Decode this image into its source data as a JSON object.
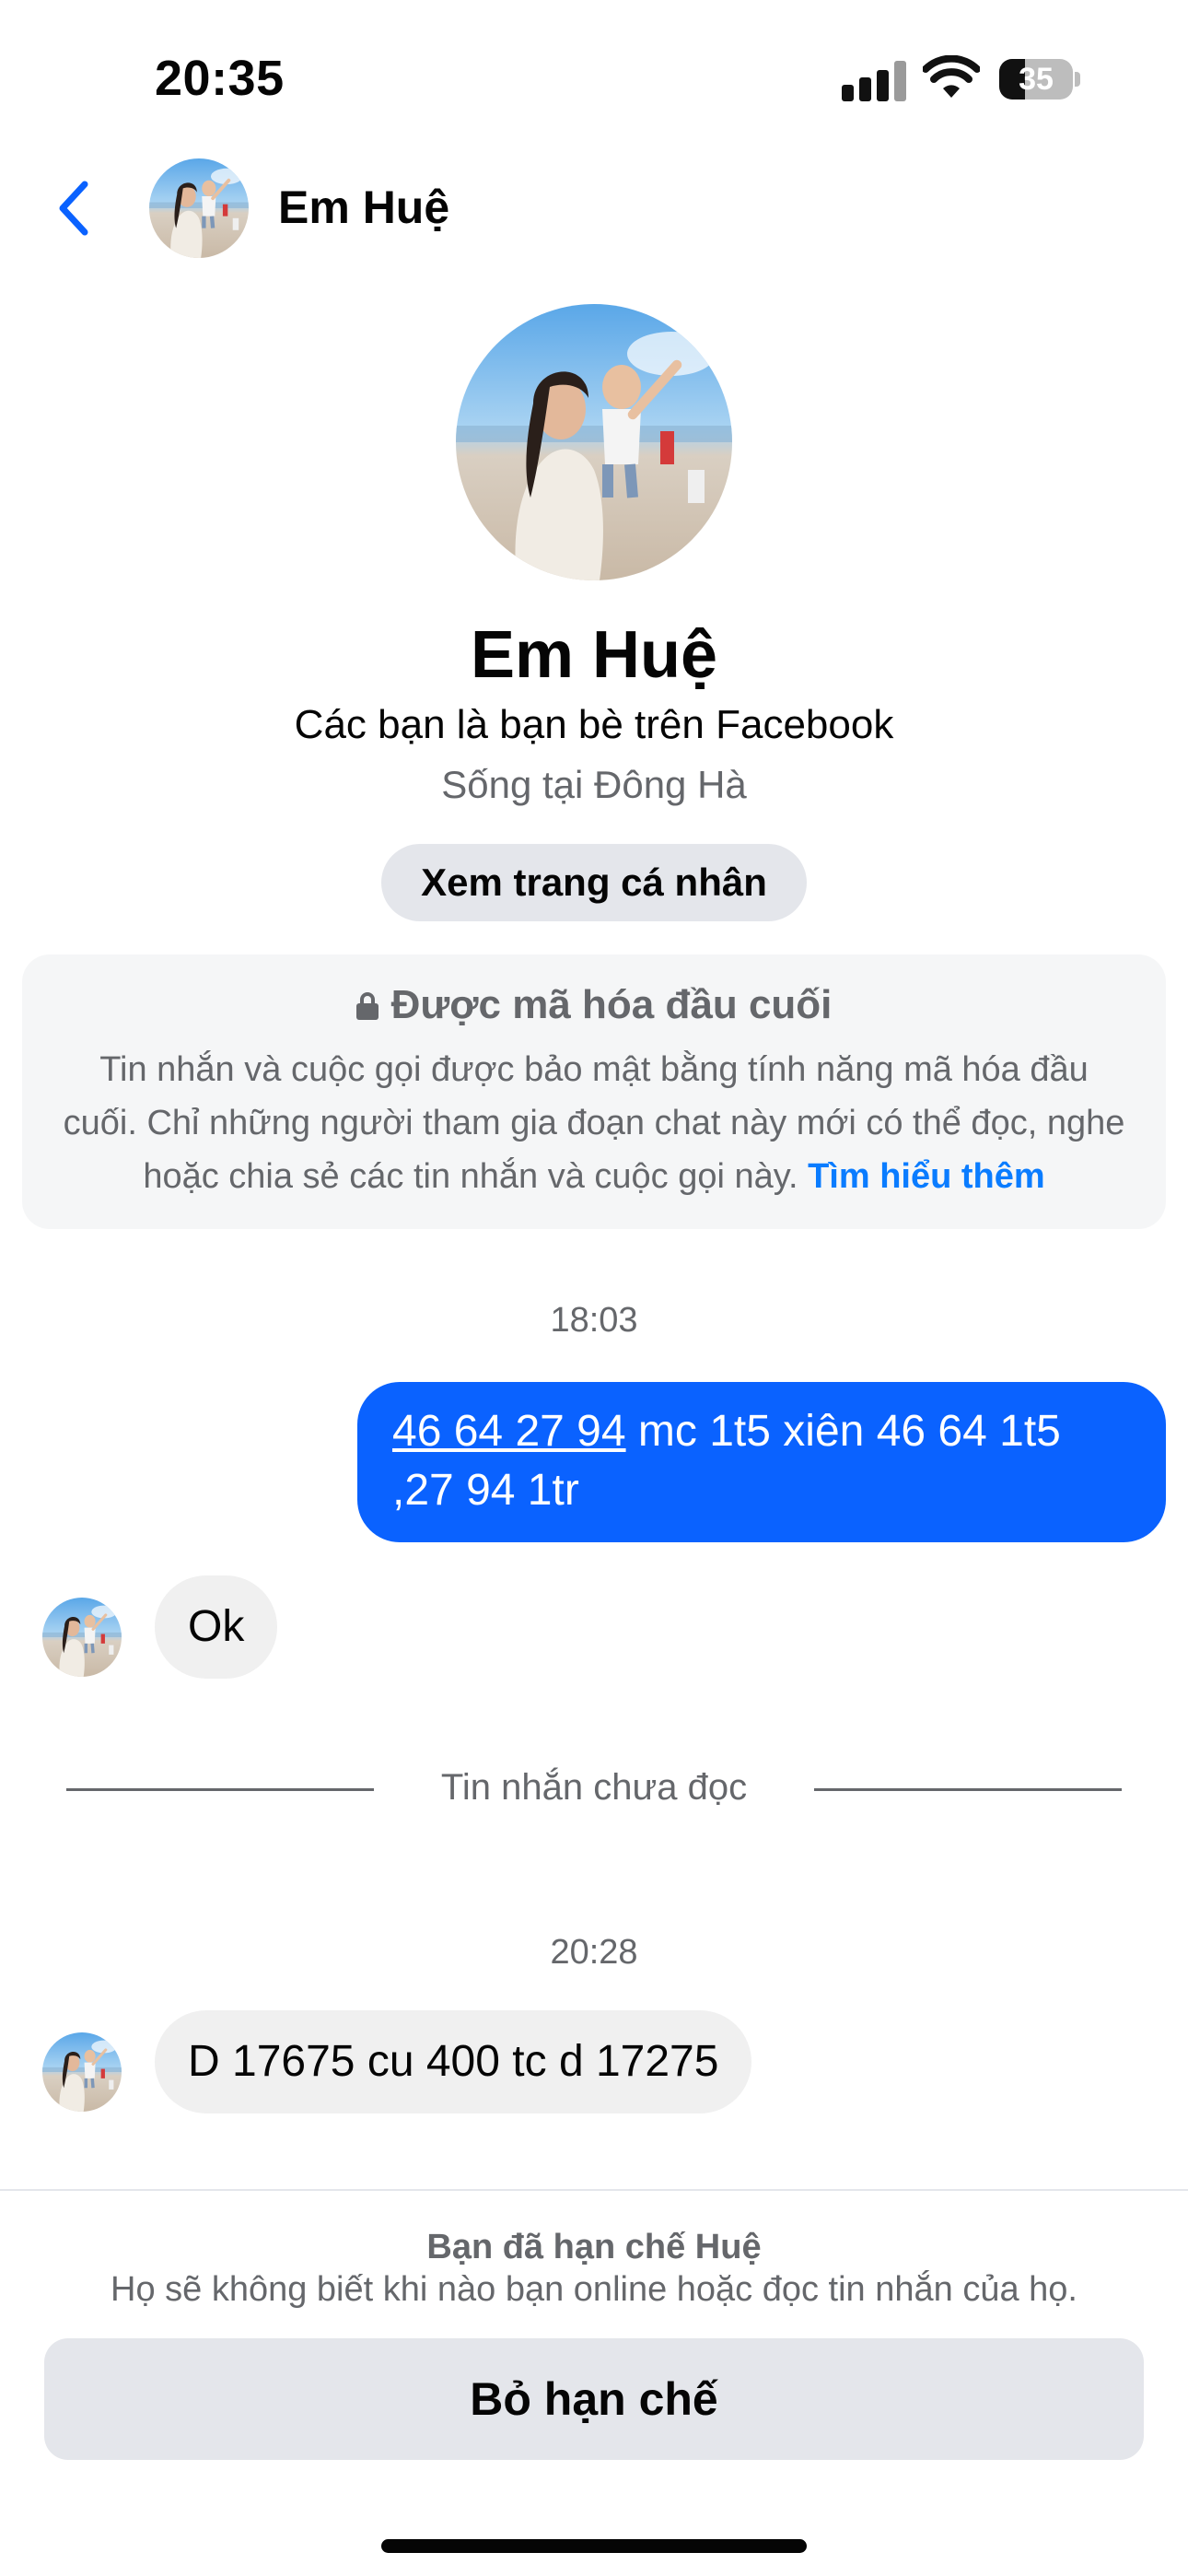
{
  "status_bar": {
    "time": "20:35",
    "battery_level": "35",
    "icons": [
      "signal-icon",
      "wifi-icon",
      "battery-icon"
    ]
  },
  "header": {
    "back_icon": "chevron-left-icon",
    "name": "Em Huệ"
  },
  "profile": {
    "name": "Em Huệ",
    "relationship": "Các bạn là bạn bè trên Facebook",
    "location": "Sống tại Đông Hà",
    "view_profile_label": "Xem trang cá nhân"
  },
  "encryption": {
    "title": "Được mã hóa đầu cuối",
    "body": "Tin nhắn và cuộc gọi được bảo mật bằng tính năng mã hóa đầu cuối. Chỉ những người tham gia đoạn chat này mới có thể đọc, nghe hoặc chia sẻ các tin nhắn và cuộc gọi này.",
    "link": "Tìm hiểu thêm"
  },
  "messages": {
    "time_1": "18:03",
    "outgoing_1_link": "46 64 27 94",
    "outgoing_1_rest": " mc 1t5 xiên 46 64 1t5 ,27 94 1tr",
    "incoming_1": "Ok",
    "unread_label": "Tin nhắn chưa đọc",
    "time_2": "20:28",
    "incoming_2": "D 17675 cu 400 tc d 17275"
  },
  "restriction": {
    "title": "Bạn đã hạn chế Huệ",
    "description": "Họ sẽ không biết khi nào bạn online hoặc đọc tin nhắn của họ.",
    "button_label": "Bỏ hạn chế"
  },
  "colors": {
    "accent_blue": "#0a62ff",
    "link_blue": "#0a7cff",
    "secondary_text": "#65676b",
    "bubble_gray": "#f0f0f0"
  }
}
